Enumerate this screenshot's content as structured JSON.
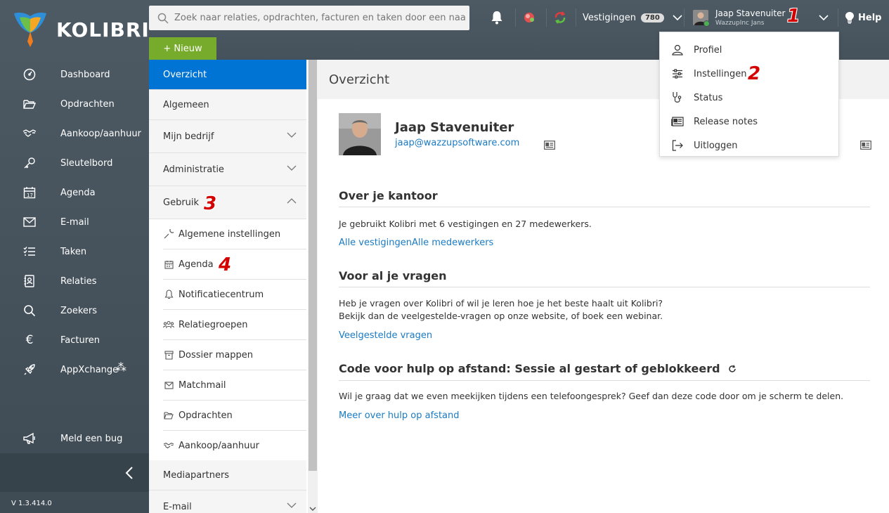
{
  "app": {
    "logo_text": "KOLIBRI",
    "version": "V 1.3.414.0"
  },
  "sidebar": {
    "items": [
      {
        "label": "Dashboard",
        "icon": "gauge-icon"
      },
      {
        "label": "Opdrachten",
        "icon": "folder-open-icon"
      },
      {
        "label": "Aankoop/aanhuur",
        "icon": "handshake-icon"
      },
      {
        "label": "Sleutelbord",
        "icon": "key-icon"
      },
      {
        "label": "Agenda",
        "icon": "calendar-icon"
      },
      {
        "label": "E-mail",
        "icon": "envelope-icon"
      },
      {
        "label": "Taken",
        "icon": "checklist-icon"
      },
      {
        "label": "Relaties",
        "icon": "contact-card-icon"
      },
      {
        "label": "Zoekers",
        "icon": "search-icon"
      },
      {
        "label": "Facturen",
        "icon": "euro-icon"
      },
      {
        "label": "AppXchange",
        "icon": "rocket-icon"
      }
    ],
    "bug_label": "Meld een bug"
  },
  "topbar": {
    "search_placeholder": "Zoek naar relaties, opdrachten, facturen en taken door een naa",
    "new_label": "+ Nieuw",
    "branches_label": "Vestigingen",
    "branches_count": "780",
    "user_name": "Jaap Stavenuiter",
    "user_org": "WazzupInc Jans",
    "help_label": "Help"
  },
  "markers": {
    "m1": "1",
    "m2": "2",
    "m3": "3",
    "m4": "4"
  },
  "submenu": {
    "overview": "Overzicht",
    "general": "Algemeen",
    "company": "Mijn bedrijf",
    "admin": "Administratie",
    "usage": "Gebruik",
    "usage_items": [
      {
        "label": "Algemene instellingen",
        "icon": "wrench-icon"
      },
      {
        "label": "Agenda",
        "icon": "calendar-icon"
      },
      {
        "label": "Notificatiecentrum",
        "icon": "bell-icon"
      },
      {
        "label": "Relatiegroepen",
        "icon": "group-icon"
      },
      {
        "label": "Dossier mappen",
        "icon": "archive-icon"
      },
      {
        "label": "Matchmail",
        "icon": "envelope-icon"
      },
      {
        "label": "Opdrachten",
        "icon": "folder-open-icon"
      },
      {
        "label": "Aankoop/aanhuur",
        "icon": "handshake-icon"
      }
    ],
    "media": "Mediapartners",
    "email": "E-mail"
  },
  "content": {
    "title": "Overzicht",
    "profile_name": "Jaap Stavenuiter",
    "profile_email": "jaap@wazzupsoftware.com",
    "office_title": "Over je kantoor",
    "office_text": "Je gebruikt Kolibri met 6 vestigingen en 27 medewerkers.",
    "office_link1": "Alle vestigingen",
    "office_link2": "Alle medewerkers",
    "questions_title": "Voor al je vragen",
    "questions_text1": "Heb je vragen over Kolibri of wil je leren hoe je het beste haalt uit Kolibri?",
    "questions_text2": "Bekijk dan de veelgestelde-vragen op onze website, of boek een webinar.",
    "questions_link": "Veelgestelde vragen",
    "remote_title": "Code voor hulp op afstand: Sessie al gestart of geblokkeerd",
    "remote_text": "Wil je graag dat we even meekijken tijdens een telefoongesprek? Geef dan deze code door om je scherm te delen.",
    "remote_link": "Meer over hulp op afstand"
  },
  "dropdown": {
    "items": [
      {
        "label": "Profiel",
        "icon": "user-icon"
      },
      {
        "label": "Instellingen",
        "icon": "sliders-icon"
      },
      {
        "label": "Status",
        "icon": "stethoscope-icon"
      },
      {
        "label": "Release notes",
        "icon": "newspaper-icon"
      },
      {
        "label": "Uitloggen",
        "icon": "logout-icon"
      }
    ]
  },
  "colors": {
    "sidebar": "#46525b",
    "accent_blue": "#0074d4",
    "new_green": "#77ab2b",
    "link": "#1a7bc4",
    "marker_red": "#d40000"
  }
}
